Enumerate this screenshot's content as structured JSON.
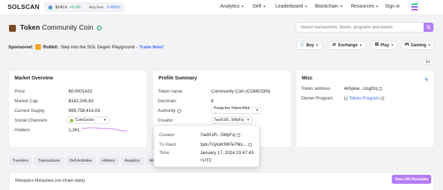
{
  "nav": {
    "logo": "SOLSCAN",
    "sol_price": "$142.6",
    "sol_change": "+6.9%",
    "fee_label": "Avg Fee:",
    "fee_value": "0.00001",
    "items": [
      "Analytics",
      "Defi",
      "Leaderboard",
      "Blockchain",
      "Resources"
    ],
    "sign_in": "Sign in"
  },
  "title": {
    "prefix": "Token",
    "name": "Community Coin"
  },
  "search": {
    "placeholder": "Search transactions, blocks, programs and tokens"
  },
  "sponsored": {
    "label": "Sponsored:",
    "brand": "Rollbit:",
    "text": "Step into the SOL Degen Playground -",
    "cta": "Trade Now!"
  },
  "actions": [
    "Buy",
    "Exchange",
    "Play",
    "Gaming"
  ],
  "market": {
    "title": "Market Overview",
    "rows": [
      {
        "label": "Price",
        "value": "$0.0001422"
      },
      {
        "label": "Market Cap",
        "value": "$142,245.62"
      },
      {
        "label": "Current Supply",
        "value": "999,758,414.03"
      },
      {
        "label": "Social Channels",
        "value": "CoinGecko"
      },
      {
        "label": "Holders",
        "value": "1,261"
      }
    ]
  },
  "profile": {
    "title": "Profile Summary",
    "rows": [
      {
        "label": "Token name",
        "value": "Community Coin (COMCOIN)"
      },
      {
        "label": "Decimals",
        "value": "6"
      },
      {
        "label": "Authority",
        "value": "Pump fun Token Mint ..."
      },
      {
        "label": "Creator",
        "value": "7wdX1R...5MyFxj"
      }
    ]
  },
  "popup": {
    "creator_label": "Creator:",
    "creator_value": "7wdX1R...5MyFxj",
    "tx_label": "Tx Hash:",
    "tx_value": "3ptu7VjAbKR6Te7Mo...",
    "time_label": "Time:",
    "time_value": "January 17, 2024 23:47:43",
    "time_zone": "+UTC"
  },
  "misc": {
    "title": "Misc",
    "token_address_label": "Token address",
    "token_address_value": "4chpew...Ucgf2q",
    "owner_program_label": "Owner Program",
    "owner_program_value": "Token Program"
  },
  "tabs": [
    "Transfers",
    "Transactions",
    "Defi Activities",
    "Holders",
    "Analytics",
    "Ma"
  ],
  "metaplex": {
    "title": "Metaplex Metadata (on-chain data)",
    "button": "View URI Metadata"
  },
  "colors": {
    "accent": "#b57bf5",
    "link": "#3a6cf4",
    "positive": "#1aa56b"
  }
}
